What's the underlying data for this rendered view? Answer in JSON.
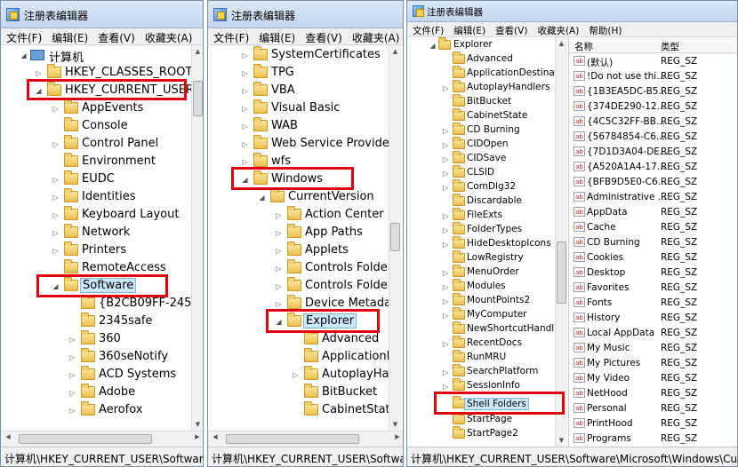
{
  "title": "注册表编辑器",
  "menus": {
    "win1": [
      "文件(F)",
      "编辑(E)",
      "查看(V)",
      "收藏夹(A)"
    ],
    "win2": [
      "文件(F)",
      "编辑(E)",
      "查看(V)",
      "收藏夹(A)"
    ],
    "win3": [
      "文件(F)",
      "编辑(E)",
      "查看(V)",
      "收藏夹(A)",
      "帮助(H)"
    ]
  },
  "win1": {
    "tree": {
      "computer": "计算机",
      "classes_root": "HKEY_CLASSES_ROOT",
      "current_user": "HKEY_CURRENT_USER",
      "children": [
        "AppEvents",
        "Console",
        "Control Panel",
        "Environment",
        "EUDC",
        "Identities",
        "Keyboard Layout",
        "Network",
        "Printers",
        "RemoteAccess"
      ],
      "software": "Software",
      "software_children": [
        "{B2CB09FF-2453",
        "2345safe",
        "360",
        "360seNotify",
        "ACD Systems",
        "Adobe",
        "Aerofox"
      ]
    },
    "status": "计算机\\HKEY_CURRENT_USER\\Software"
  },
  "win2": {
    "tree": {
      "top": [
        "SystemCertificates",
        "TPG",
        "VBA",
        "Visual Basic",
        "WAB",
        "Web Service Providers",
        "wfs"
      ],
      "windows": "Windows",
      "current_version": "CurrentVersion",
      "cv_children": [
        "Action Center",
        "App Paths",
        "Applets",
        "Controls Folder",
        "Controls Folder",
        "Device Metadat"
      ],
      "explorer": "Explorer",
      "explorer_children": [
        "Advanced",
        "ApplicationD",
        "AutoplayHar",
        "BitBucket",
        "CabinetState"
      ]
    },
    "status": "计算机\\HKEY_CURRENT_USER\\Software"
  },
  "win3": {
    "tree": {
      "explorer": "Explorer",
      "children": [
        "Advanced",
        "ApplicationDestinati",
        "AutoplayHandlers",
        "BitBucket",
        "CabinetState",
        "CD Burning",
        "CIDOpen",
        "CIDSave",
        "CLSID",
        "ComDlg32",
        "Discardable",
        "FileExts",
        "FolderTypes",
        "HideDesktopIcons",
        "LowRegistry",
        "MenuOrder",
        "Modules",
        "MountPoints2",
        "MyComputer",
        "NewShortcutHandler",
        "RecentDocs",
        "RunMRU",
        "SearchPlatform",
        "SessionInfo"
      ],
      "shell_folders": "Shell Folders",
      "after": [
        "StartPage",
        "StartPage2"
      ]
    },
    "list": {
      "col_name": "名称",
      "col_type": "类型",
      "rows": [
        {
          "name": "(默认)",
          "type": "REG_SZ"
        },
        {
          "name": "!Do not use thi...",
          "type": "REG_SZ"
        },
        {
          "name": "{1B3EA5DC-B5...",
          "type": "REG_SZ"
        },
        {
          "name": "{374DE290-12...",
          "type": "REG_SZ"
        },
        {
          "name": "{4C5C32FF-BB...",
          "type": "REG_SZ"
        },
        {
          "name": "{56784854-C6...",
          "type": "REG_SZ"
        },
        {
          "name": "{7D1D3A04-DE...",
          "type": "REG_SZ"
        },
        {
          "name": "{A520A1A4-17...",
          "type": "REG_SZ"
        },
        {
          "name": "{BFB9D5E0-C6...",
          "type": "REG_SZ"
        },
        {
          "name": "Administrative ...",
          "type": "REG_SZ"
        },
        {
          "name": "AppData",
          "type": "REG_SZ"
        },
        {
          "name": "Cache",
          "type": "REG_SZ"
        },
        {
          "name": "CD Burning",
          "type": "REG_SZ"
        },
        {
          "name": "Cookies",
          "type": "REG_SZ"
        },
        {
          "name": "Desktop",
          "type": "REG_SZ"
        },
        {
          "name": "Favorites",
          "type": "REG_SZ"
        },
        {
          "name": "Fonts",
          "type": "REG_SZ"
        },
        {
          "name": "History",
          "type": "REG_SZ"
        },
        {
          "name": "Local AppData",
          "type": "REG_SZ"
        },
        {
          "name": "My Music",
          "type": "REG_SZ"
        },
        {
          "name": "My Pictures",
          "type": "REG_SZ"
        },
        {
          "name": "My Video",
          "type": "REG_SZ"
        },
        {
          "name": "NetHood",
          "type": "REG_SZ"
        },
        {
          "name": "Personal",
          "type": "REG_SZ"
        },
        {
          "name": "PrintHood",
          "type": "REG_SZ"
        },
        {
          "name": "Programs",
          "type": "REG_SZ"
        }
      ]
    },
    "status": "计算机\\HKEY_CURRENT_USER\\Software\\Microsoft\\Windows\\CurrentVersion\\Explorer\\Shell Folders"
  },
  "colors": {
    "highlight_box": "#e1000f",
    "selection": "#cce8ff",
    "titlebar": "#c4d6ee"
  }
}
